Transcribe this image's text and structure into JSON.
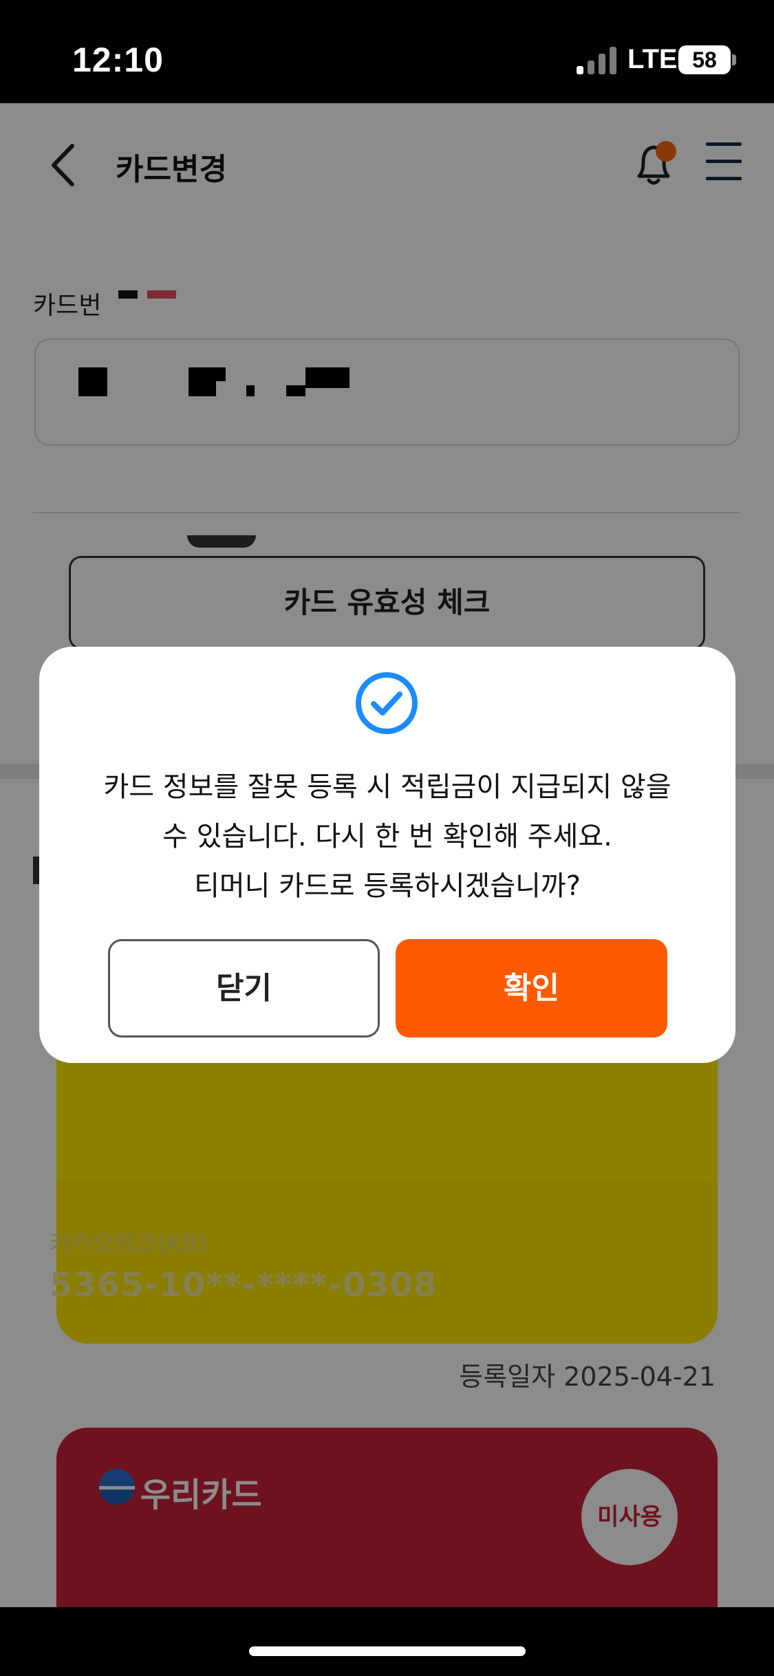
{
  "status_bar": {
    "time": "12:10",
    "network": "LTE",
    "battery": "58"
  },
  "header": {
    "title": "카드변경",
    "back_icon": "chevron-left-icon",
    "notification_icon": "bell-icon",
    "menu_icon": "hamburger-menu-icon"
  },
  "form": {
    "card_number_label": "카드번",
    "validity_button": "카드 유효성 체크"
  },
  "cards": [
    {
      "bank": "카카오뱅크(KB)",
      "number": "5365-10**-****-0308",
      "registered": "등록일자 2025-04-21",
      "color": "#ffe500"
    },
    {
      "bank": "우리카드",
      "badge": "미사용",
      "color": "#c8213a"
    }
  ],
  "dialog": {
    "icon": "check-circle-icon",
    "line1": "카드 정보를 잘못 등록 시 적립금이 지급되지 않을",
    "line2": "수 있습니다. 다시 한 번 확인해 주세요.",
    "line3": "티머니 카드로 등록하시겠습니까?",
    "close_label": "닫기",
    "confirm_label": "확인",
    "accent_color": "#ff5a00"
  }
}
